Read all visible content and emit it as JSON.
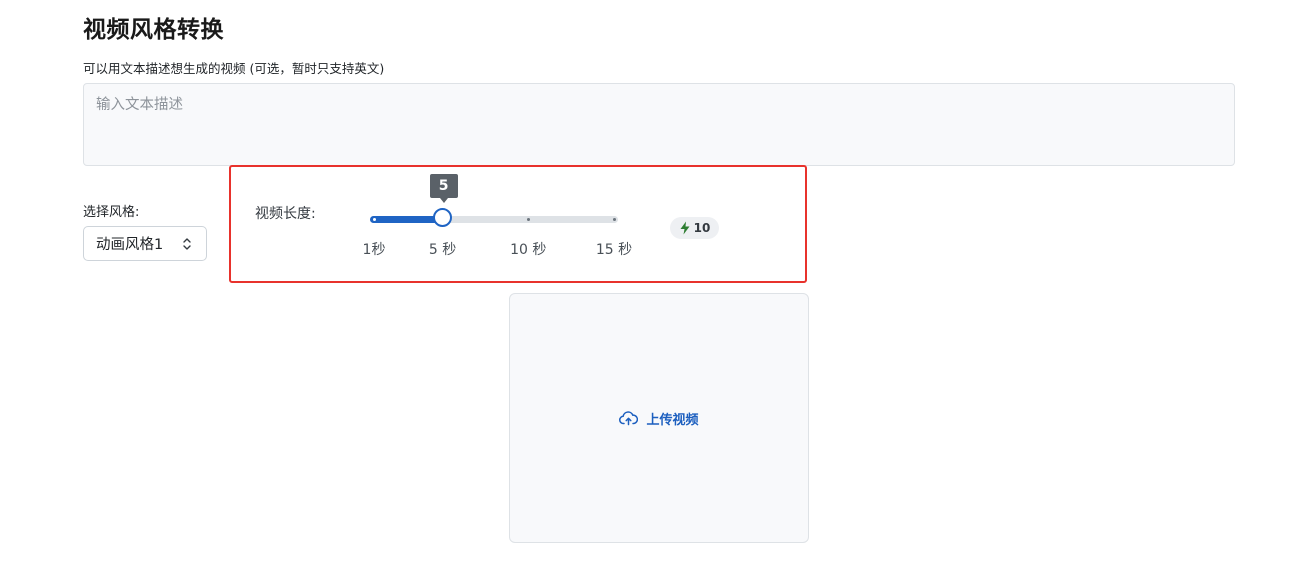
{
  "page": {
    "title": "视频风格转换"
  },
  "prompt": {
    "label": "可以用文本描述想生成的视频 (可选，暂时只支持英文)",
    "value": "",
    "placeholder": "输入文本描述"
  },
  "style": {
    "label": "选择风格:",
    "selected": "动画风格1"
  },
  "video_length": {
    "label": "视频长度:",
    "value": 5,
    "value_label": "5",
    "min": 1,
    "max": 15,
    "ticks": [
      {
        "value": 1,
        "label": "1秒"
      },
      {
        "value": 5,
        "label": "5 秒"
      },
      {
        "value": 10,
        "label": "10 秒"
      },
      {
        "value": 15,
        "label": "15 秒"
      }
    ]
  },
  "credits": {
    "icon": "lightning-icon",
    "value": "10"
  },
  "upload": {
    "icon": "cloud-upload-icon",
    "label": "上传视频"
  },
  "colors": {
    "accent": "#1f64c4",
    "highlight": "#e8322c",
    "credit_icon": "#2e7d32"
  }
}
